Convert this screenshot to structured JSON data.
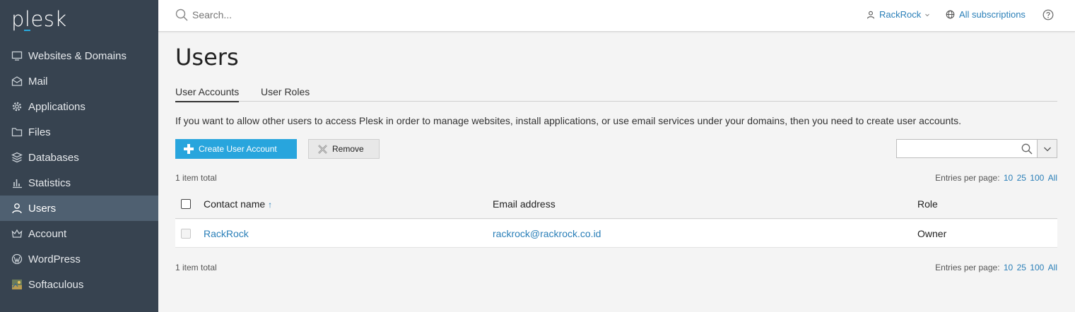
{
  "brand": {
    "logo_text": "plesk",
    "accent": "#28aade"
  },
  "sidebar": {
    "items": [
      {
        "label": "Websites & Domains",
        "icon": "monitor-icon"
      },
      {
        "label": "Mail",
        "icon": "mail-icon"
      },
      {
        "label": "Applications",
        "icon": "gear-icon"
      },
      {
        "label": "Files",
        "icon": "folder-icon"
      },
      {
        "label": "Databases",
        "icon": "database-icon"
      },
      {
        "label": "Statistics",
        "icon": "bar-chart-icon"
      },
      {
        "label": "Users",
        "icon": "user-icon",
        "active": true
      },
      {
        "label": "Account",
        "icon": "crown-icon"
      },
      {
        "label": "WordPress",
        "icon": "wordpress-icon"
      },
      {
        "label": "Softaculous",
        "icon": "softaculous-icon"
      }
    ]
  },
  "header": {
    "search_placeholder": "Search...",
    "user_label": "RackRock",
    "subscriptions_label": "All subscriptions"
  },
  "main": {
    "title": "Users",
    "tabs": [
      {
        "label": "User Accounts",
        "active": true
      },
      {
        "label": "User Roles",
        "active": false
      }
    ],
    "description": "If you want to allow other users to access Plesk in order to manage websites, install applications, or use email services under your domains, then you need to create user accounts.",
    "create_button": "Create User Account",
    "remove_button": "Remove",
    "total_label": "1 item total",
    "entries_label": "Entries per page:",
    "entries_options": [
      "10",
      "25",
      "100",
      "All"
    ],
    "columns": {
      "contact": "Contact name",
      "email": "Email address",
      "role": "Role"
    },
    "rows": [
      {
        "contact": "RackRock",
        "email": "rackrock@rackrock.co.id",
        "role": "Owner"
      }
    ]
  }
}
